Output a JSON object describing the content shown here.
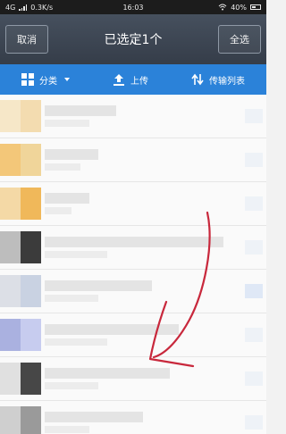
{
  "status_bar": {
    "network": "4G",
    "speed": "0.3K/s",
    "time": "16:03",
    "battery": "40%"
  },
  "header": {
    "cancel_label": "取消",
    "title": "已选定1个",
    "select_all_label": "全选"
  },
  "toolbar": {
    "category_label": "分类",
    "upload_label": "上传",
    "transfer_list_label": "传输列表"
  },
  "colors": {
    "toolbar_blue": "#2b82d9",
    "header_dark": "#3d4653",
    "annotation_red": "#c8283c"
  },
  "icons": {
    "category": "grid-icon",
    "upload": "upload-icon",
    "transfer": "transfer-arrows-icon"
  }
}
